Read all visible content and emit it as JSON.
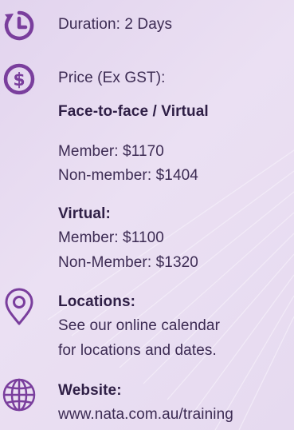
{
  "duration": {
    "label": "Duration: 2 Days",
    "icon": "clock-icon"
  },
  "price": {
    "label": "Price (Ex GST):",
    "icon": "dollar-icon",
    "face_to_face": {
      "heading": "Face-to-face / Virtual",
      "member": "Member: $1170",
      "non_member": "Non-member: $1404"
    },
    "virtual": {
      "heading": "Virtual:",
      "member": "Member: $1100",
      "non_member": "Non-Member: $1320"
    }
  },
  "locations": {
    "heading": "Locations:",
    "line1": "See our online calendar",
    "line2": "for locations and dates.",
    "icon": "location-pin-icon"
  },
  "website": {
    "heading": "Website:",
    "url": "www.nata.com.au/training",
    "icon": "globe-icon"
  },
  "colors": {
    "accent": "#7a3e9d",
    "text": "#3c2b53",
    "background": "#e8dcf1"
  }
}
